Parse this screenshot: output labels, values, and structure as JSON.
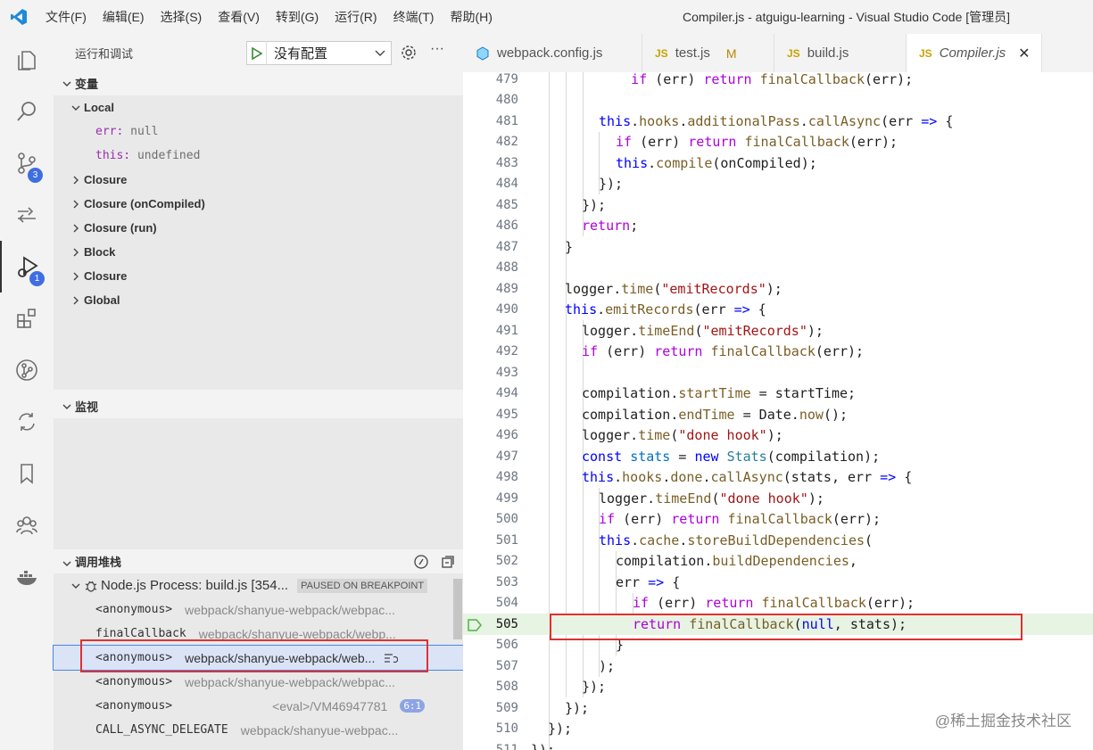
{
  "titlebar": {
    "menu": [
      "文件(F)",
      "编辑(E)",
      "选择(S)",
      "查看(V)",
      "转到(G)",
      "运行(R)",
      "终端(T)",
      "帮助(H)"
    ],
    "title": "Compiler.js - atguigu-learning - Visual Studio Code [管理员]"
  },
  "activity": {
    "scm_badge": "3",
    "debug_badge": "1"
  },
  "sidebar": {
    "header": "运行和调试",
    "config": "没有配置",
    "variables_title": "变量",
    "local_label": "Local",
    "locals": [
      {
        "name": "err:",
        "value": "null"
      },
      {
        "name": "this:",
        "value": "undefined"
      }
    ],
    "scopes": [
      "Closure",
      "Closure (onCompiled)",
      "Closure (run)",
      "Block",
      "Closure",
      "Global"
    ],
    "watch_title": "监视",
    "callstack_title": "调用堆栈",
    "process": "Node.js Process: build.js [354...",
    "paused": "PAUSED ON BREAKPOINT",
    "frames": [
      {
        "fn": "<anonymous>",
        "src": "webpack/shanyue-webpack/webpac..."
      },
      {
        "fn": "finalCallback",
        "src": "webpack/shanyue-webpack/webp..."
      },
      {
        "fn": "<anonymous>",
        "src": "webpack/shanyue-webpack/web..."
      },
      {
        "fn": "<anonymous>",
        "src": "webpack/shanyue-webpack/webpac..."
      },
      {
        "fn": "<anonymous>",
        "src": "<eval>/VM46947781",
        "badge": "6:1"
      },
      {
        "fn": "CALL_ASYNC_DELEGATE",
        "src": "webpack/shanyue-webpac..."
      }
    ]
  },
  "tabs": [
    {
      "label": "webpack.config.js",
      "icon": "webpack-icon"
    },
    {
      "label": "test.js",
      "icon": "JS",
      "modified": "M"
    },
    {
      "label": "build.js",
      "icon": "JS"
    },
    {
      "label": "Compiler.js",
      "icon": "JS"
    }
  ],
  "editor": {
    "line_numbers": [
      "479",
      "480",
      "481",
      "482",
      "483",
      "484",
      "485",
      "486",
      "487",
      "488",
      "489",
      "490",
      "491",
      "492",
      "493",
      "494",
      "495",
      "496",
      "497",
      "498",
      "499",
      "500",
      "501",
      "502",
      "503",
      "504",
      "505",
      "506",
      "507",
      "508",
      "509",
      "510",
      "511"
    ],
    "current_line": "505"
  },
  "watermark": "@稀土掘金技术社区"
}
